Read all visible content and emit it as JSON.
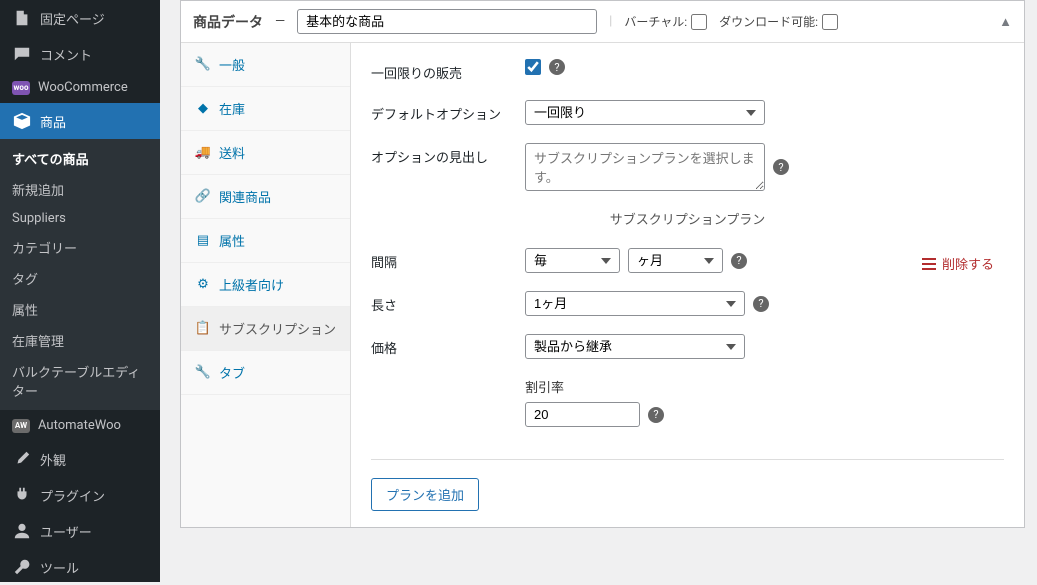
{
  "sidebar": {
    "items": [
      {
        "label": "固定ページ",
        "icon": "page"
      },
      {
        "label": "コメント",
        "icon": "comment"
      },
      {
        "label": "WooCommerce",
        "icon": "woo"
      },
      {
        "label": "商品",
        "icon": "box",
        "active": true
      },
      {
        "label": "AutomateWoo",
        "icon": "aw"
      },
      {
        "label": "外観",
        "icon": "brush"
      },
      {
        "label": "プラグイン",
        "icon": "plug"
      },
      {
        "label": "ユーザー",
        "icon": "user"
      },
      {
        "label": "ツール",
        "icon": "wrench"
      }
    ],
    "sub": [
      {
        "label": "すべての商品",
        "current": true
      },
      {
        "label": "新規追加"
      },
      {
        "label": "Suppliers"
      },
      {
        "label": "カテゴリー"
      },
      {
        "label": "タグ"
      },
      {
        "label": "属性"
      },
      {
        "label": "在庫管理"
      },
      {
        "label": "バルクテーブルエディター"
      }
    ]
  },
  "panel": {
    "title": "商品データ",
    "product_type": "基本的な商品",
    "virtual_label": "バーチャル:",
    "downloadable_label": "ダウンロード可能:"
  },
  "tabs": [
    {
      "label": "一般",
      "icon": "wrench"
    },
    {
      "label": "在庫",
      "icon": "inventory"
    },
    {
      "label": "送料",
      "icon": "truck"
    },
    {
      "label": "関連商品",
      "icon": "link"
    },
    {
      "label": "属性",
      "icon": "list"
    },
    {
      "label": "上級者向け",
      "icon": "gear"
    },
    {
      "label": "サブスクリプション",
      "icon": "clipboard",
      "active": true
    },
    {
      "label": "タブ",
      "icon": "wrench"
    }
  ],
  "form": {
    "one_time": {
      "label": "一回限りの販売",
      "checked": true
    },
    "default_option": {
      "label": "デフォルトオプション",
      "value": "一回限り"
    },
    "option_heading": {
      "label": "オプションの見出し",
      "placeholder": "サブスクリプションプランを選択します。"
    },
    "plan_section_title": "サブスクリプションプラン",
    "interval": {
      "label": "間隔",
      "every": "毎",
      "unit": "ヶ月"
    },
    "length": {
      "label": "長さ",
      "value": "1ヶ月"
    },
    "price": {
      "label": "価格",
      "value": "製品から継承"
    },
    "discount": {
      "label": "割引率",
      "value": "20"
    },
    "remove_label": "削除する",
    "add_plan_label": "プランを追加"
  }
}
